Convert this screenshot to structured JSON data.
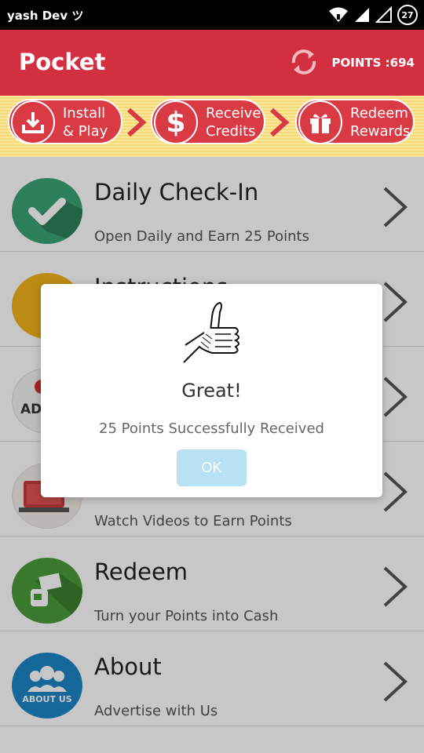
{
  "status": {
    "user": "yash Dev ツ",
    "battery": "27"
  },
  "header": {
    "title": "Pocket",
    "points": "POINTS :694"
  },
  "steps": [
    {
      "line1": "Install",
      "line2": "& Play"
    },
    {
      "line1": "Receive",
      "line2": "Credits"
    },
    {
      "line1": "Redeem",
      "line2": "Rewards"
    }
  ],
  "list": [
    {
      "title": "Daily Check-In",
      "subtitle": "Open Daily and Earn 25 Points"
    },
    {
      "title": "Instructions",
      "subtitle": ""
    },
    {
      "title": "",
      "subtitle": ""
    },
    {
      "title": "",
      "subtitle": "Watch Videos to Earn Points"
    },
    {
      "title": "Redeem",
      "subtitle": "Turn your Points into Cash"
    },
    {
      "title": "About",
      "subtitle": "Advertise with Us"
    }
  ],
  "icon_labels": {
    "ads": "AD",
    "about": "ABOUT US"
  },
  "dialog": {
    "title": "Great!",
    "message": "25 Points Successfully Received",
    "ok_label": "OK"
  },
  "colors": {
    "primary": "#d23040",
    "ok_button": "#b6e2f4",
    "checkin_icon": "#3aa377",
    "info_icon": "#f0b21a",
    "redeem_icon": "#4a9a3a",
    "about_icon": "#1b86c4"
  }
}
